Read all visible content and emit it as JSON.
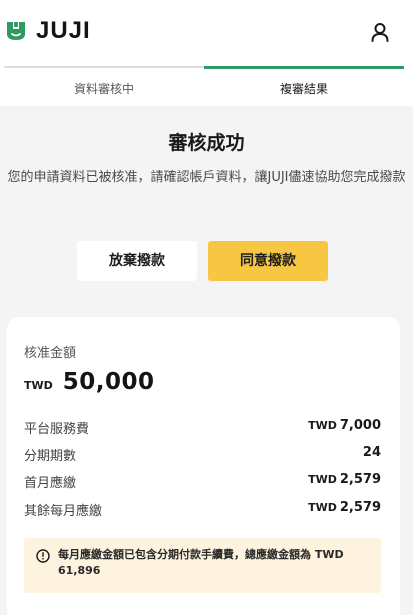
{
  "header": {
    "brand": "JUJI",
    "brand_color": "#2e9a62",
    "logo_icon": "juji-logo-icon",
    "account_icon": "user-icon"
  },
  "tabs": [
    {
      "label": "資料審核中",
      "active": false
    },
    {
      "label": "複審結果",
      "active": true
    }
  ],
  "result": {
    "title": "審核成功",
    "description": "您的申請資料已被核准，請確認帳戶資料，讓JUJI儘速協助您完成撥款"
  },
  "actions": {
    "reject_label": "放棄撥款",
    "accept_label": "同意撥款",
    "accept_color": "#f7c743"
  },
  "summary": {
    "approved_label": "核准金額",
    "currency": "TWD",
    "approved_amount": "50,000",
    "rows": [
      {
        "label": "平台服務費",
        "currency": "TWD",
        "value": "7,000"
      },
      {
        "label": "分期期數",
        "currency": "",
        "value": "24"
      },
      {
        "label": "首月應繳",
        "currency": "TWD",
        "value": "2,579"
      },
      {
        "label": "其餘每月應繳",
        "currency": "TWD",
        "value": "2,579"
      }
    ],
    "notice_icon": "info-icon",
    "notice": "每月應繳金額已包含分期付款手續費，總應繳金額為 TWD 61,896"
  }
}
